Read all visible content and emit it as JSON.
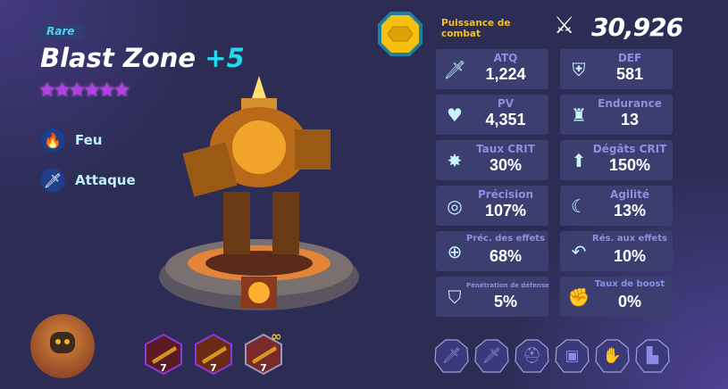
{
  "hero": {
    "rarity": "Rare",
    "name": "Blast Zone",
    "enhance": "+5",
    "stars": 6,
    "element": "Feu",
    "role": "Attaque"
  },
  "combat_power": {
    "label": "Puissance de combat",
    "value": "30,926"
  },
  "stats": [
    {
      "label": "ATQ",
      "value": "1,224",
      "icon": "sword-icon"
    },
    {
      "label": "DEF",
      "value": "581",
      "icon": "shield-icon"
    },
    {
      "label": "PV",
      "value": "4,351",
      "icon": "heart-icon"
    },
    {
      "label": "Endurance",
      "value": "13",
      "icon": "castle-shield-icon"
    },
    {
      "label": "Taux CRIT",
      "value": "30%",
      "icon": "burst-icon"
    },
    {
      "label": "Dégâts CRIT",
      "value": "150%",
      "icon": "arrow-up-icon"
    },
    {
      "label": "Précision",
      "value": "107%",
      "icon": "target-arrow-icon"
    },
    {
      "label": "Agilité",
      "value": "13%",
      "icon": "agility-icon"
    },
    {
      "label": "Préc. des effets",
      "value": "68%",
      "icon": "crosshair-icon"
    },
    {
      "label": "Rés. aux effets",
      "value": "10%",
      "icon": "return-arrow-icon"
    },
    {
      "label": "Pénétration de défense",
      "value": "5%",
      "icon": "pierced-shield-icon"
    },
    {
      "label": "Taux de boost",
      "value": "0%",
      "icon": "boost-fist-icon"
    }
  ],
  "skills": [
    {
      "level": "7"
    },
    {
      "level": "7"
    },
    {
      "level": "7",
      "badge": "∞"
    }
  ],
  "equipment": [
    "weapon-icon",
    "weapon-icon",
    "helmet-icon",
    "armor-icon",
    "glove-icon",
    "boot-icon"
  ],
  "colors": {
    "background": "#2c2c54",
    "card": "#3c3e70",
    "accent": "#22dcee",
    "gold": "#f2c21a",
    "star": "#b43ee8"
  }
}
